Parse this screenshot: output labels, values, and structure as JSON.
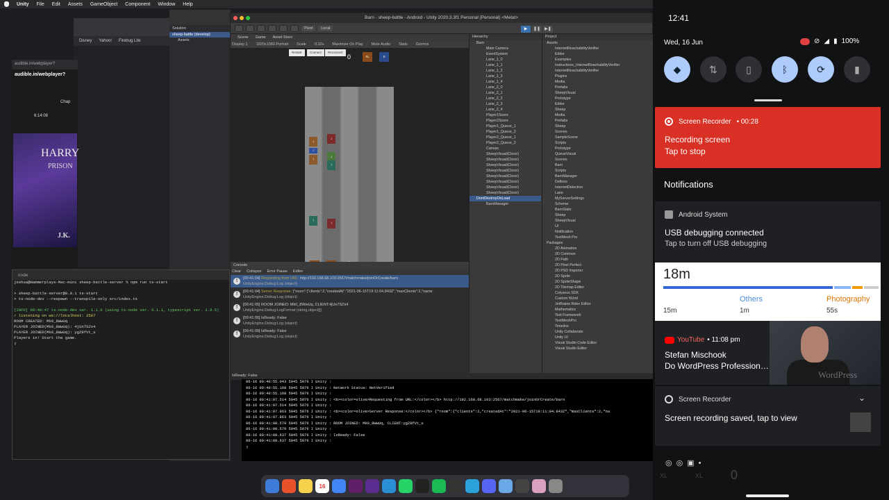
{
  "menubar": {
    "apple": "",
    "items": [
      "Unity",
      "File",
      "Edit",
      "Assets",
      "GameObject",
      "Component",
      "Window",
      "Help"
    ]
  },
  "browser": {
    "bookmarks": [
      "Disney",
      "Yahoo!",
      "Firebug Lite"
    ]
  },
  "audible": {
    "url": "audible.in/webplayer?",
    "chapter": "Chap",
    "time": "6:14:08",
    "cover_title": "HARRY",
    "cover_sub": "PRISON",
    "cover_author": "J.K."
  },
  "solution": {
    "header": "Solution",
    "project": "sheep-battle (develop)",
    "assets": "Assets"
  },
  "terminal": {
    "title": "node",
    "lines": [
      "joshua@Hammerplays-Mac-mini sheep-battle-server % npm run ts-start",
      "",
      "> sheep-battle-server@0.0.1 ts-start",
      "> ts-node-dev --respawn --transpile-only src/index.ts",
      "",
      "[INFO] 00:40:47 ts-node-dev ver. 1.1.6 (using ts-node ver. 9.1.1, typescript ver. 3.9.5)",
      "✓ listening on ws://localhost: 2567",
      "ROOM CREATED: Mk0_8WwUq",
      "PLAYER JOINED(Mk0_8WwUq): 4jUn7SZx4",
      "PLAYER JOINED(Mk0_8WwUq): ygZ8fVt_u",
      "Players in! Start the game."
    ]
  },
  "unity": {
    "title": "Barn - sheep-battle - Android - Unity 2020.3.3f1 Personal (Personal) <Metal>",
    "toolbar": {
      "pivot": "Pivot",
      "local": "Local"
    },
    "tabs": [
      "Scene",
      "Game",
      "Asset Store"
    ],
    "game_opts": [
      "Display 1",
      "1920x1080 Portrait",
      "Scale",
      "0.32x",
      "Maximize On Play",
      "Mute Audio",
      "Stats",
      "Gizmos"
    ],
    "game_buttons": [
      "Restart",
      "Connect",
      "Reconnect"
    ],
    "top_score": "0",
    "bottom_score": "0",
    "chip_xl": "XL",
    "chip_s": "S",
    "hierarchy_title": "Hierarchy",
    "hierarchy": [
      "Barn",
      "Main Camera",
      "EventSystem",
      "Lane_1_0",
      "Lane_1_1",
      "Lane_1_2",
      "Lane_1_3",
      "Lane_1_4",
      "Lane_2_0",
      "Lane_2_1",
      "Lane_2_2",
      "Lane_2_3",
      "Lane_2_4",
      "Player1Score",
      "Player2Score",
      "Player1_Queue_1",
      "Player1_Queue_2",
      "Player2_Queue_1",
      "Player2_Queue_2",
      "Canvas",
      "SheepVisual(Clone)",
      "SheepVisual(Clone)",
      "SheepVisual(Clone)",
      "SheepVisual(Clone)",
      "SheepVisual(Clone)",
      "SheepVisual(Clone)",
      "SheepVisual(Clone)",
      "SheepVisual(Clone)",
      "DontDestroyOnLoad",
      "BarnManager"
    ],
    "project_title": "Project",
    "project": [
      "Assets",
      "InternetReachabilityVerifier",
      "Editor",
      "Examples",
      "Instructions_InternetReachabilityVerifier",
      "InternetReachabilityVerifier",
      "Plugins",
      "Media",
      "Prefabs",
      "SheepVisual",
      "Prototype",
      "Editor",
      "Sheep",
      "Media",
      "Prefabs",
      "Sheep",
      "Scenes",
      "SampleScene",
      "Scripts",
      "Prototype",
      "QueueVisual",
      "Scenes",
      "Barn",
      "Scripts",
      "BarnManager",
      "Defines",
      "InternetDetection",
      "Lane",
      "MyServerSettings",
      "Scheme",
      "BarnState",
      "Sheep",
      "SheepVisual",
      "UI",
      "Notification",
      "TextMesh Pro",
      "Packages",
      "2D Animation",
      "2D Common",
      "2D Path",
      "2D Pixel Perfect",
      "2D PSD Importer",
      "2D Sprite",
      "2D SpriteShape",
      "2D Tilemap Editor",
      "Colyseus SDK",
      "Custom NUnit",
      "JetBrains Rider Editor",
      "Mathematics",
      "Test Framework",
      "TextMeshPro",
      "Timeline",
      "Unity Collaborate",
      "Unity UI",
      "Visual Studio Code Editor",
      "Visual Studio Editor"
    ],
    "console_title": "Console",
    "console_opts": [
      "Clear",
      "Collapse",
      "Error Pause",
      "Editor"
    ],
    "console_rows": [
      {
        "time": "[00:41:04]",
        "tag": "Requesting from URL:",
        "msg": " http://192.168.68.103:2567/matchmake/joinOrCreate/barn",
        "sub": "UnityEngine.Debug:Log (object)"
      },
      {
        "time": "[00:41:04]",
        "tag": "Server Response:",
        "msg": " {\"room\":{\"clients\":2,\"createdAt\":\"2021-06-15T19:11:04.843Z\",\"maxClients\":2,\"name",
        "sub": "UnityEngine.Debug:Log (object)"
      },
      {
        "time": "[00:41:05]",
        "tag": "",
        "msg": "ROOM JOINED: Mk0_8WwUq, CLIENT:4jUn7SZx4",
        "sub": "UnityEngine.Debug:LogFormat (string,object[])"
      },
      {
        "time": "[00:41:05]",
        "tag": "",
        "msg": "IsReady: False",
        "sub": "UnityEngine.Debug:Log (object)"
      },
      {
        "time": "[00:41:09]",
        "tag": "",
        "msg": "IsReady: False",
        "sub": "UnityEngine.Debug:Log (object)"
      }
    ],
    "status": "IsReady: False"
  },
  "logcat": [
    "06-16 00:40:55.043  5045  5076 I Unity   :",
    "06-16 00:40:55.168  5045  5076 I Unity   : Network Status: NetVerified",
    "06-16 00:40:55.168  5045  5076 I Unity   :",
    "06-16 00:41:07.514  5045  5076 I Unity   : <b><color=olive>Requesting from URL:</color></b>  http://192.168.68.103:2567/matchmake/joinOrCreate/barn",
    "06-16 00:41:07.514  5045  5076 I Unity   :",
    "06-16 00:41:07.863  5045  5076 I Unity   : <b><color=olive>Server Response:</color></b>  {\"room\":{\"clients\":2,\"createdAt\":\"2021-06-15T19:11:04.843Z\",\"maxClients\":2,\"na",
    "06-16 00:41:07.863  5045  5076 I Unity   :",
    "06-16 00:41:08.579  5045  5076 I Unity   : ROOM JOINED: Mk0_8WwUq, CLIENT:ygZ8fVt_u",
    "06-16 00:41:08.579  5045  5076 I Unity   :",
    "06-16 00:41:08.637  5045  5076 I Unity   : IsReady: False",
    "06-16 00:41:08.637  5045  5076 I Unity   :"
  ],
  "dock": [
    "Finder",
    "Brave",
    "Notes",
    "Calendar",
    "Chrome",
    "Slack",
    "Visual Studio",
    "VS Code",
    "WhatsApp",
    "Terminal",
    "Spotify",
    "Unity",
    "Telegram",
    "Discord",
    "Preview",
    "Unity Hub",
    "Photos",
    "Trash"
  ],
  "calendar_day": "16",
  "android": {
    "clock": "12:41",
    "date": "Wed, 16 Jun",
    "battery": "100%",
    "recorder": {
      "title": "Screen Recorder",
      "elapsed": "00:28",
      "line1": "Recording screen",
      "line2": "Tap to stop"
    },
    "notifications_label": "Notifications",
    "usb": {
      "app": "Android System",
      "title": "USB debugging connected",
      "body": "Tap to turn off USB debugging"
    },
    "usage": {
      "total": "18m",
      "left_time": "15m",
      "others_label": "Others",
      "others_time": "1m",
      "photo_label": "Photography",
      "photo_time": "55s",
      "bar_fractions": [
        0.8,
        0.08,
        0.05,
        0.07
      ],
      "bar_colors": [
        "#3367d6",
        "#8ab4f8",
        "#f29900",
        "#cccccc"
      ]
    },
    "youtube": {
      "app": "YouTube",
      "time": "11:08 pm",
      "title": "Stefan Mischook",
      "body": "Do WordPress Profession…",
      "thumb_text": "WordPress"
    },
    "saved": {
      "app": "Screen Recorder",
      "body": "Screen recording saved, tap to view"
    },
    "ghost_xl": "XL",
    "ghost_zero": "0"
  }
}
